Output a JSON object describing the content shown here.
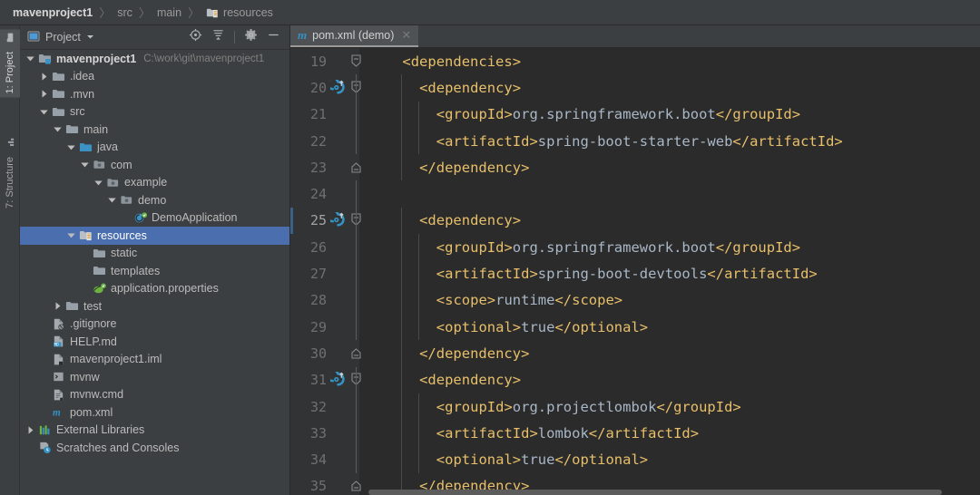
{
  "breadcrumb": {
    "items": [
      {
        "label": "mavenproject1",
        "icon": "",
        "style": "first"
      },
      {
        "label": "src",
        "icon": "",
        "style": "dim"
      },
      {
        "label": "main",
        "icon": "",
        "style": "dim"
      },
      {
        "label": "resources",
        "icon": "resources-folder-icon",
        "style": "dim"
      }
    ],
    "separator": "〉"
  },
  "rail": {
    "tabs": [
      {
        "label": "1: Project",
        "icon": "project-folder-icon",
        "active": true
      },
      {
        "label": "7: Structure",
        "icon": "structure-bars-icon",
        "active": false
      }
    ]
  },
  "project_panel": {
    "title": "Project",
    "dropdown_icon": "chevron-down-icon",
    "view_icon": "project-view-icon",
    "tools": [
      {
        "name": "locate-icon",
        "title": "Select Opened File"
      },
      {
        "name": "collapse-all-icon",
        "title": "Collapse All"
      },
      {
        "name": "gear-icon",
        "title": "Settings"
      },
      {
        "name": "minimize-icon",
        "title": "Hide"
      }
    ],
    "tree": [
      {
        "label": "mavenproject1",
        "path": "C:\\work\\git\\mavenproject1",
        "depth": 0,
        "arrow": "down",
        "icon": "module-folder-icon",
        "bold": true,
        "selected": false
      },
      {
        "label": ".idea",
        "depth": 1,
        "arrow": "right",
        "icon": "folder-icon",
        "bold": false,
        "selected": false
      },
      {
        "label": ".mvn",
        "depth": 1,
        "arrow": "right",
        "icon": "folder-icon",
        "bold": false,
        "selected": false
      },
      {
        "label": "src",
        "depth": 1,
        "arrow": "down",
        "icon": "folder-icon",
        "bold": false,
        "selected": false
      },
      {
        "label": "main",
        "depth": 2,
        "arrow": "down",
        "icon": "folder-icon",
        "bold": false,
        "selected": false
      },
      {
        "label": "java",
        "depth": 3,
        "arrow": "down",
        "icon": "source-folder-icon",
        "bold": false,
        "selected": false
      },
      {
        "label": "com",
        "depth": 4,
        "arrow": "down",
        "icon": "package-icon",
        "bold": false,
        "selected": false
      },
      {
        "label": "example",
        "depth": 5,
        "arrow": "down",
        "icon": "package-icon",
        "bold": false,
        "selected": false
      },
      {
        "label": "demo",
        "depth": 6,
        "arrow": "down",
        "icon": "package-icon",
        "bold": false,
        "selected": false
      },
      {
        "label": "DemoApplication",
        "depth": 7,
        "arrow": "none",
        "icon": "spring-class-icon",
        "bold": false,
        "selected": false
      },
      {
        "label": "resources",
        "depth": 3,
        "arrow": "down",
        "icon": "resources-folder-icon",
        "bold": false,
        "selected": true
      },
      {
        "label": "static",
        "depth": 4,
        "arrow": "none",
        "icon": "folder-icon",
        "bold": false,
        "selected": false
      },
      {
        "label": "templates",
        "depth": 4,
        "arrow": "none",
        "icon": "folder-icon",
        "bold": false,
        "selected": false
      },
      {
        "label": "application.properties",
        "depth": 4,
        "arrow": "none",
        "icon": "spring-properties-icon",
        "bold": false,
        "selected": false
      },
      {
        "label": "test",
        "depth": 2,
        "arrow": "right",
        "icon": "folder-icon",
        "bold": false,
        "selected": false
      },
      {
        "label": ".gitignore",
        "depth": 1,
        "arrow": "none",
        "icon": "gitignore-file-icon",
        "bold": false,
        "selected": false
      },
      {
        "label": "HELP.md",
        "depth": 1,
        "arrow": "none",
        "icon": "markdown-file-icon",
        "bold": false,
        "selected": false
      },
      {
        "label": "mavenproject1.iml",
        "depth": 1,
        "arrow": "none",
        "icon": "iml-file-icon",
        "bold": false,
        "selected": false
      },
      {
        "label": "mvnw",
        "depth": 1,
        "arrow": "none",
        "icon": "script-file-icon",
        "bold": false,
        "selected": false
      },
      {
        "label": "mvnw.cmd",
        "depth": 1,
        "arrow": "none",
        "icon": "cmd-file-icon",
        "bold": false,
        "selected": false
      },
      {
        "label": "pom.xml",
        "depth": 1,
        "arrow": "none",
        "icon": "maven-file-icon",
        "bold": false,
        "selected": false
      },
      {
        "label": "External Libraries",
        "depth": 0,
        "arrow": "right",
        "icon": "libraries-icon",
        "bold": false,
        "selected": false
      },
      {
        "label": "Scratches and Consoles",
        "depth": 0,
        "arrow": "none",
        "icon": "scratches-icon",
        "bold": false,
        "selected": false
      }
    ]
  },
  "editor": {
    "tabs": [
      {
        "label": "pom.xml (demo)",
        "icon": "maven-file-icon",
        "close_icon": "close-icon",
        "active": true
      }
    ],
    "close_glyph": "✕",
    "lines": [
      {
        "num": "19",
        "indent": 2,
        "fold": "collapse",
        "current": false,
        "gutter_icon": "none",
        "segs": [
          {
            "t": "tag",
            "s": "<dependencies>"
          }
        ]
      },
      {
        "num": "20",
        "indent": 3,
        "fold": "collapse",
        "current": false,
        "gutter_icon": "dependency-update-icon",
        "segs": [
          {
            "t": "tag",
            "s": "<dependency>"
          }
        ]
      },
      {
        "num": "21",
        "indent": 4,
        "fold": "none",
        "current": false,
        "gutter_icon": "none",
        "segs": [
          {
            "t": "tag",
            "s": "<groupId>"
          },
          {
            "t": "txt",
            "s": "org.springframework.boot"
          },
          {
            "t": "tag",
            "s": "</groupId>"
          }
        ]
      },
      {
        "num": "22",
        "indent": 4,
        "fold": "none",
        "current": false,
        "gutter_icon": "none",
        "segs": [
          {
            "t": "tag",
            "s": "<artifactId>"
          },
          {
            "t": "txt",
            "s": "spring-boot-starter-web"
          },
          {
            "t": "tag",
            "s": "</artifactId>"
          }
        ]
      },
      {
        "num": "23",
        "indent": 3,
        "fold": "end",
        "current": false,
        "gutter_icon": "none",
        "segs": [
          {
            "t": "tag",
            "s": "</dependency>"
          }
        ]
      },
      {
        "num": "24",
        "indent": 0,
        "fold": "none",
        "current": false,
        "gutter_icon": "none",
        "segs": []
      },
      {
        "num": "25",
        "indent": 3,
        "fold": "collapse",
        "current": true,
        "gutter_icon": "dependency-update-icon",
        "segs": [
          {
            "t": "tag",
            "s": "<dependency>"
          }
        ]
      },
      {
        "num": "26",
        "indent": 4,
        "fold": "none",
        "current": false,
        "gutter_icon": "none",
        "segs": [
          {
            "t": "tag",
            "s": "<groupId>"
          },
          {
            "t": "txt",
            "s": "org.springframework.boot"
          },
          {
            "t": "tag",
            "s": "</groupId>"
          }
        ]
      },
      {
        "num": "27",
        "indent": 4,
        "fold": "none",
        "current": false,
        "gutter_icon": "none",
        "segs": [
          {
            "t": "tag",
            "s": "<artifactId>"
          },
          {
            "t": "txt",
            "s": "spring-boot-devtools"
          },
          {
            "t": "tag",
            "s": "</artifactId>"
          }
        ]
      },
      {
        "num": "28",
        "indent": 4,
        "fold": "none",
        "current": false,
        "gutter_icon": "none",
        "segs": [
          {
            "t": "tag",
            "s": "<scope>"
          },
          {
            "t": "txt",
            "s": "runtime"
          },
          {
            "t": "tag",
            "s": "</scope>"
          }
        ]
      },
      {
        "num": "29",
        "indent": 4,
        "fold": "none",
        "current": false,
        "gutter_icon": "none",
        "segs": [
          {
            "t": "tag",
            "s": "<optional>"
          },
          {
            "t": "txt",
            "s": "true"
          },
          {
            "t": "tag",
            "s": "</optional>"
          }
        ]
      },
      {
        "num": "30",
        "indent": 3,
        "fold": "end",
        "current": false,
        "gutter_icon": "none",
        "segs": [
          {
            "t": "tag",
            "s": "</dependency>"
          }
        ]
      },
      {
        "num": "31",
        "indent": 3,
        "fold": "collapse",
        "current": false,
        "gutter_icon": "dependency-update-icon",
        "segs": [
          {
            "t": "tag",
            "s": "<dependency>"
          }
        ]
      },
      {
        "num": "32",
        "indent": 4,
        "fold": "none",
        "current": false,
        "gutter_icon": "none",
        "segs": [
          {
            "t": "tag",
            "s": "<groupId>"
          },
          {
            "t": "txt",
            "s": "org.projectlombok"
          },
          {
            "t": "tag",
            "s": "</groupId>"
          }
        ]
      },
      {
        "num": "33",
        "indent": 4,
        "fold": "none",
        "current": false,
        "gutter_icon": "none",
        "segs": [
          {
            "t": "tag",
            "s": "<artifactId>"
          },
          {
            "t": "txt",
            "s": "lombok"
          },
          {
            "t": "tag",
            "s": "</artifactId>"
          }
        ]
      },
      {
        "num": "34",
        "indent": 4,
        "fold": "none",
        "current": false,
        "gutter_icon": "none",
        "segs": [
          {
            "t": "tag",
            "s": "<optional>"
          },
          {
            "t": "txt",
            "s": "true"
          },
          {
            "t": "tag",
            "s": "</optional>"
          }
        ]
      },
      {
        "num": "35",
        "indent": 3,
        "fold": "end",
        "current": false,
        "gutter_icon": "none",
        "segs": [
          {
            "t": "tag",
            "s": "</dependency>"
          }
        ]
      }
    ]
  },
  "colors": {
    "background": "#3c3f41",
    "editor_background": "#2b2b2b",
    "gutter_background": "#313335",
    "selection_blue": "#4b6eaf",
    "xml_tag": "#e8bf6a",
    "xml_text": "#a9b7c6",
    "accent_blue": "#3592c4",
    "line_number": "#707070"
  }
}
